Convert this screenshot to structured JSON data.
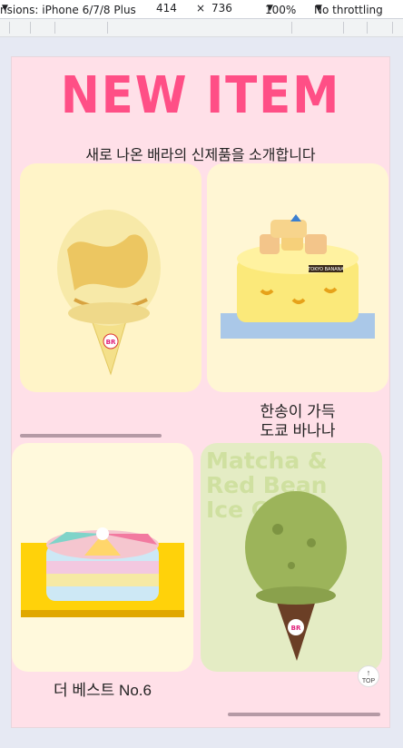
{
  "devtools": {
    "device_label": "nsions: iPhone 6/7/8 Plus",
    "width": "414",
    "times": "×",
    "height": "736",
    "zoom": "100%",
    "throttle": "No throttling"
  },
  "page": {
    "title": "NEW ITEM",
    "subtitle": "새로 나온 배라의 신제품을 소개합니다",
    "items": [
      {
        "name": ""
      },
      {
        "name_line1": "한송이 가득",
        "name_line2": "도쿄 바나나",
        "cake_label": "TOKYO BANANA"
      },
      {
        "name": "더 베스트 No.6"
      },
      {
        "overlay_text": "Matcha &\nRed Bean\nIce Cre"
      }
    ],
    "top_button": {
      "arrow": "↑",
      "label": "TOP"
    },
    "brand_badge": "BR"
  },
  "colors": {
    "title": "#ff4f86",
    "background": "#ffe0e8"
  }
}
